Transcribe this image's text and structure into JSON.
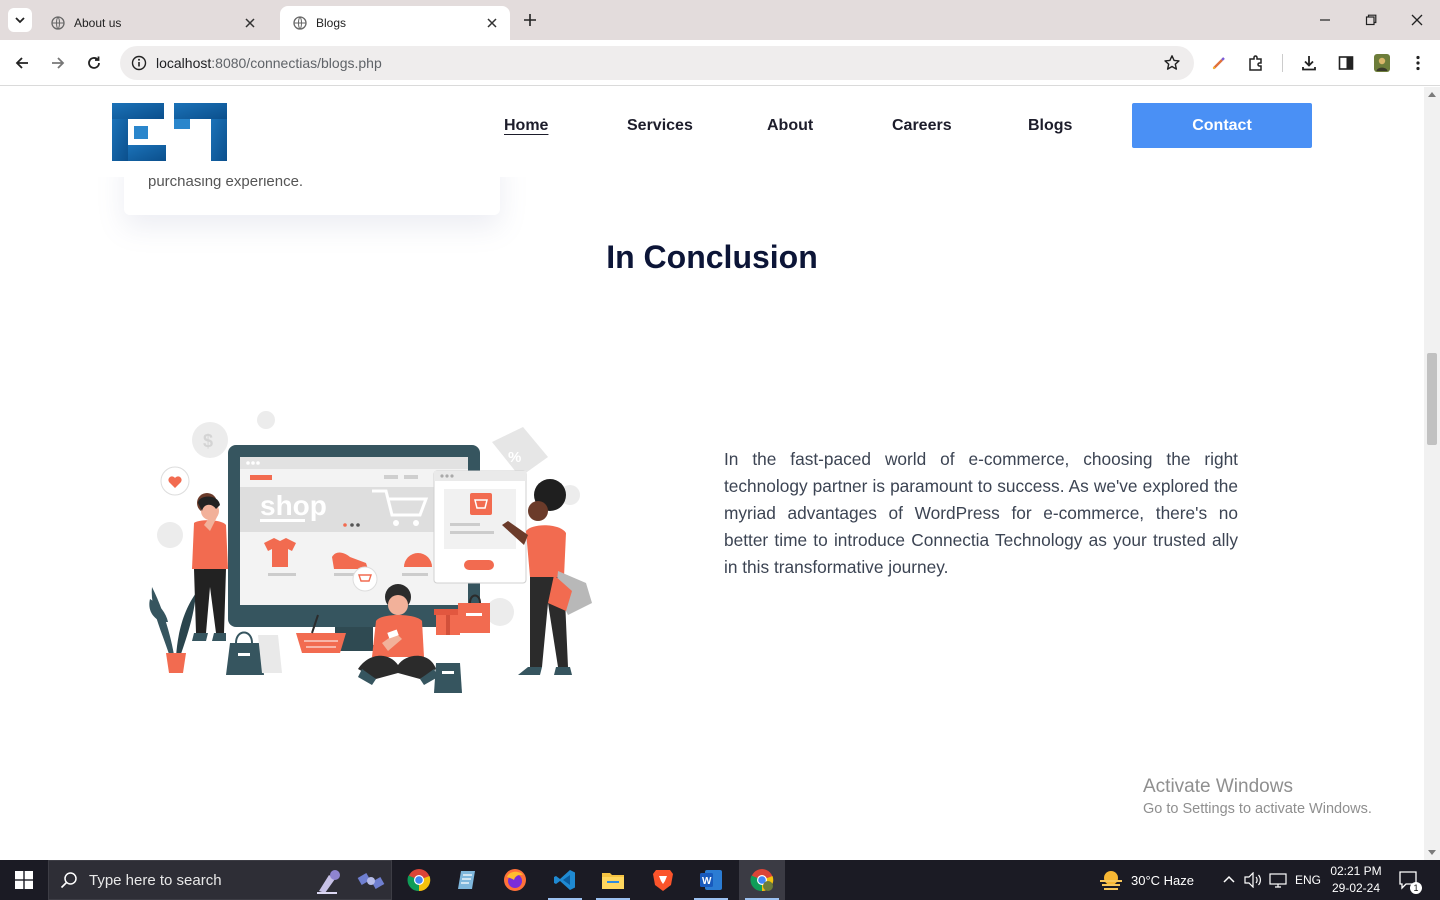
{
  "browser": {
    "tabs": [
      {
        "title": "About us",
        "active": false
      },
      {
        "title": "Blogs",
        "active": true
      }
    ],
    "url_host": "localhost",
    "url_path": ":8080/connectias/blogs.php"
  },
  "site": {
    "nav": {
      "home": "Home",
      "services": "Services",
      "about": "About",
      "careers": "Careers",
      "blogs": "Blogs",
      "contact": "Contact"
    },
    "brand_color": "#4a90f5"
  },
  "content": {
    "previous_card_text": "purchasing experience.",
    "section_title": "In Conclusion",
    "illustration_label": "shop",
    "paragraph": "In the fast-paced world of e-commerce, choosing the right technology partner is paramount to success. As we've explored the myriad advantages of WordPress for e-commerce, there's no better time to introduce Connectia Technology as your trusted ally in this transformative journey."
  },
  "watermark": {
    "line1": "Activate Windows",
    "line2": "Go to Settings to activate Windows."
  },
  "taskbar": {
    "search_placeholder": "Type here to search",
    "weather": "30°C  Haze",
    "language": "ENG",
    "time": "02:21 PM",
    "date": "29-02-24",
    "notification_count": "1"
  }
}
